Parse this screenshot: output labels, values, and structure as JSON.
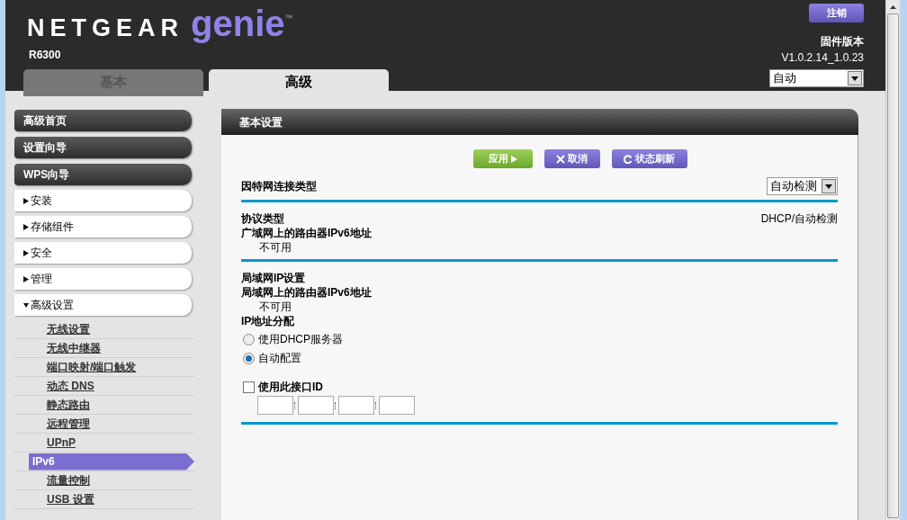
{
  "header": {
    "brand": "NETGEAR",
    "product": "genie",
    "trademark": "™",
    "model": "R6300",
    "logout": "注销",
    "firmware_label": "固件版本",
    "firmware_version": "V1.0.2.14_1.0.23",
    "language": {
      "value": "自动"
    }
  },
  "tabs": [
    {
      "label": "基本",
      "selected": false
    },
    {
      "label": "高级",
      "selected": true
    }
  ],
  "sidebar": {
    "items": [
      {
        "kind": "button",
        "label": "高级首页"
      },
      {
        "kind": "button",
        "label": "设置向导"
      },
      {
        "kind": "button",
        "label": "WPS向导"
      },
      {
        "kind": "section",
        "label": "安装",
        "expanded": false
      },
      {
        "kind": "section",
        "label": "存储组件",
        "expanded": false
      },
      {
        "kind": "section",
        "label": "安全",
        "expanded": false
      },
      {
        "kind": "section",
        "label": "管理",
        "expanded": false
      },
      {
        "kind": "section",
        "label": "高级设置",
        "expanded": true,
        "children": [
          {
            "label": "无线设置",
            "selected": false
          },
          {
            "label": "无线中继器",
            "selected": false
          },
          {
            "label": "端口映射/端口触发",
            "selected": false
          },
          {
            "label": "动态 DNS",
            "selected": false
          },
          {
            "label": "静态路由",
            "selected": false
          },
          {
            "label": "远程管理",
            "selected": false
          },
          {
            "label": "UPnP",
            "selected": false
          },
          {
            "label": "IPv6",
            "selected": true
          },
          {
            "label": "流量控制",
            "selected": false
          },
          {
            "label": "USB 设置",
            "selected": false
          }
        ]
      }
    ]
  },
  "panel": {
    "title": "基本设置",
    "buttons": [
      {
        "kind": "apply",
        "label": "应用"
      },
      {
        "kind": "cancel",
        "label": "取消"
      },
      {
        "kind": "refresh",
        "label": "状态刷新"
      }
    ],
    "connection_type": {
      "label": "因特网连接类型",
      "value": "自动检测"
    },
    "wan": {
      "protocol_label": "协议类型",
      "protocol_value": "DHCP/自动检测",
      "address_label": "广域网上的路由器IPv6地址",
      "address_value": "不可用"
    },
    "lan": {
      "title": "局域网IP设置",
      "address_label": "局域网上的路由器IPv6地址",
      "address_value": "不可用",
      "assignment_label": "IP地址分配",
      "options": [
        {
          "label": "使用DHCP服务器",
          "selected": false
        },
        {
          "label": "自动配置",
          "selected": true
        }
      ],
      "interface_id": {
        "label": "使用此接口ID",
        "checked": false
      }
    }
  }
}
